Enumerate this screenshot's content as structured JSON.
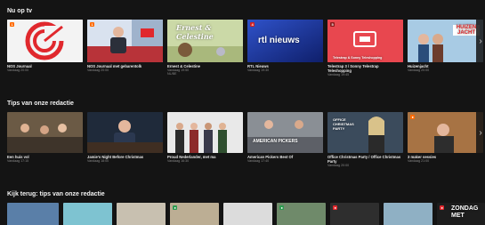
{
  "sections": {
    "now_on_tv": {
      "title": "Nu op tv",
      "cards": [
        {
          "title": "NOS Journaal",
          "sub": "Vandaag 20:00",
          "sub2": "",
          "badge": "1"
        },
        {
          "title": "NOS Journaal met gebarentolk",
          "sub": "Vandaag 20:00",
          "sub2": "",
          "badge": "1"
        },
        {
          "title": "Ernest & Celestine",
          "sub": "Vandaag 19:50",
          "sub2": "NL/BE",
          "overlay": "Ernest & Celestine"
        },
        {
          "title": "RTL Nieuws",
          "sub": "Vandaag 19:30",
          "sub2": "",
          "overlay": "rtl nieuws",
          "badge": "4"
        },
        {
          "title": "Telestrap 3 / Sonny Telestrap Teleshopping",
          "sub": "Vandaag 19:45",
          "sub2": "",
          "badge": "5",
          "overlay": "Telestrap & Sonny Teleshopping"
        },
        {
          "title": "Huizenjacht",
          "sub": "Vandaag 20:00",
          "sub2": "",
          "overlay": "HUIZEN JACHT"
        }
      ]
    },
    "tips": {
      "title": "Tips van onze redactie",
      "cards": [
        {
          "title": "Een huis vol",
          "sub": "Vandaag 17:15",
          "sub2": ""
        },
        {
          "title": "Jamie's Night Before Christmas",
          "sub": "Vandaag 18:00",
          "sub2": ""
        },
        {
          "title": "Proud Nederlander, met ma",
          "sub": "Vandaag 16:30",
          "sub2": ""
        },
        {
          "title": "American Pickers Best Of",
          "sub": "Vandaag 17:40",
          "sub2": "",
          "overlay": "AMERICAN PICKERS"
        },
        {
          "title": "Office Christmas Party / Office Christmas Party",
          "sub": "Vandaag 20:00",
          "sub2": "",
          "overlay": "OFFICE CHRISTMAS PARTY"
        },
        {
          "title": "3 maker sessies",
          "sub": "Vandaag 21:00",
          "sub2": ""
        }
      ]
    },
    "watch_back": {
      "title": "Kijk terug: tips van onze redactie",
      "cards": [
        {
          "overlay": ""
        },
        {
          "overlay": ""
        },
        {
          "overlay": ""
        },
        {
          "overlay": ""
        },
        {
          "overlay": ""
        },
        {
          "overlay": ""
        },
        {
          "overlay": ""
        },
        {
          "overlay": "ZONDAG MET"
        }
      ]
    }
  },
  "icons": {
    "next_arrow": "chevron-right-icon",
    "channel_badge": "channel-logo-icon"
  },
  "colors": {
    "background": "#141414",
    "npo_orange": "#ff6a00",
    "rtl_blue": "#1e3fae"
  }
}
